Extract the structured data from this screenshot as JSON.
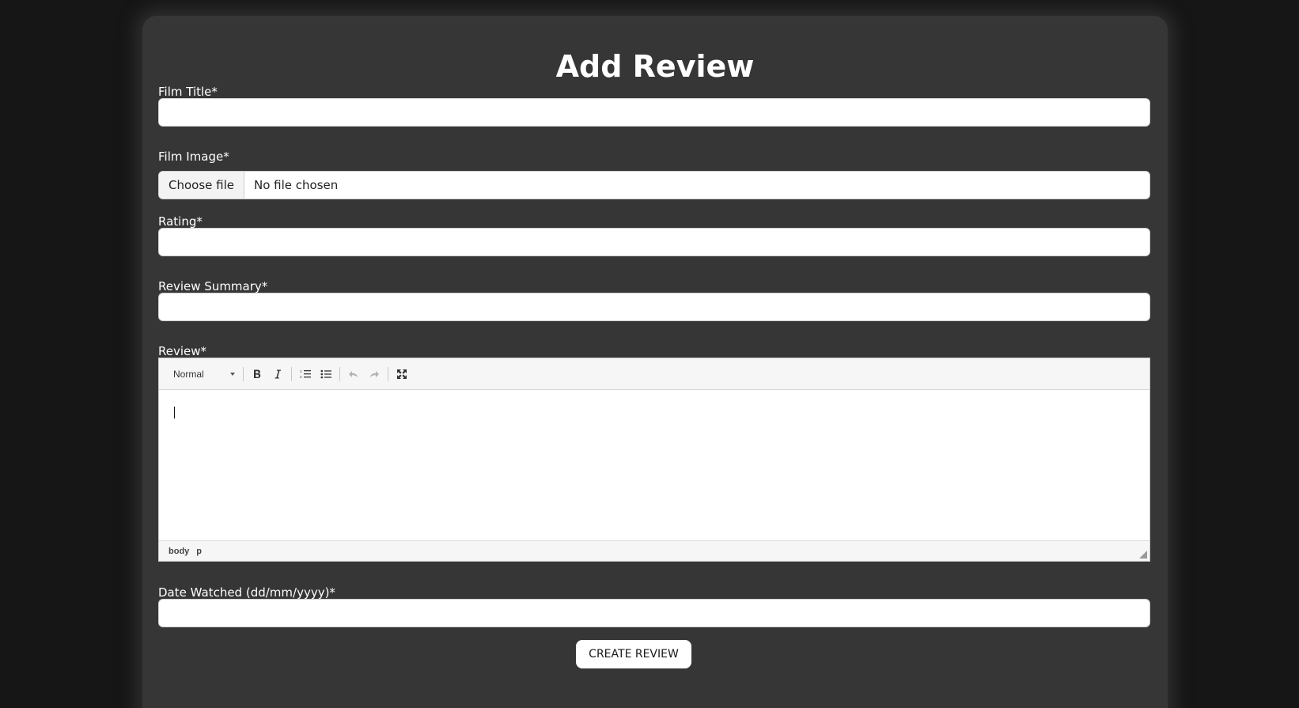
{
  "form": {
    "title": "Add Review",
    "film_title": {
      "label": "Film Title*",
      "value": ""
    },
    "film_image": {
      "label": "Film Image*",
      "button_label": "Choose file",
      "status": "No file chosen"
    },
    "rating": {
      "label": "Rating*",
      "value": ""
    },
    "review_summary": {
      "label": "Review Summary*",
      "value": ""
    },
    "review": {
      "label": "Review*",
      "toolbar": {
        "format_select": "Normal",
        "buttons": [
          "bold-icon",
          "italic-icon",
          "ordered-list-icon",
          "bullet-list-icon",
          "undo-icon",
          "redo-icon",
          "fullscreen-icon"
        ]
      },
      "statusbar": [
        "body",
        "p"
      ]
    },
    "date_watched": {
      "label": "Date Watched (dd/mm/yyyy)*",
      "value": ""
    },
    "submit_label": "CREATE REVIEW"
  },
  "colors": {
    "background": "#161616",
    "card": "#363636",
    "text": "#ffffff"
  }
}
